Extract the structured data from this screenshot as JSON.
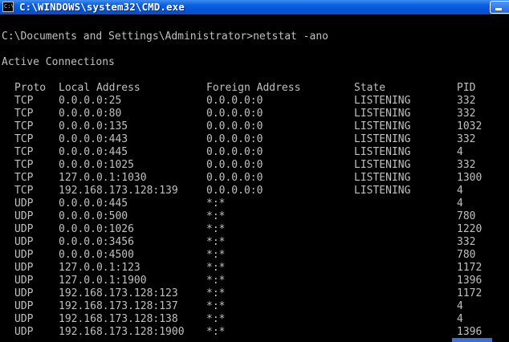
{
  "window": {
    "title": "C:\\WINDOWS\\system32\\CMD.exe",
    "icon_text": "C:\\"
  },
  "console": {
    "prompt_command": "C:\\Documents and Settings\\Administrator>netstat -ano",
    "section_heading": "Active Connections",
    "columns": {
      "proto": "Proto",
      "local": "Local Address",
      "foreign": "Foreign Address",
      "state": "State",
      "pid": "PID"
    },
    "rows": [
      {
        "proto": "TCP",
        "local": "0.0.0.0:25",
        "foreign": "0.0.0.0:0",
        "state": "LISTENING",
        "pid": "332"
      },
      {
        "proto": "TCP",
        "local": "0.0.0.0:80",
        "foreign": "0.0.0.0:0",
        "state": "LISTENING",
        "pid": "332"
      },
      {
        "proto": "TCP",
        "local": "0.0.0.0:135",
        "foreign": "0.0.0.0:0",
        "state": "LISTENING",
        "pid": "1032"
      },
      {
        "proto": "TCP",
        "local": "0.0.0.0:443",
        "foreign": "0.0.0.0:0",
        "state": "LISTENING",
        "pid": "332"
      },
      {
        "proto": "TCP",
        "local": "0.0.0.0:445",
        "foreign": "0.0.0.0:0",
        "state": "LISTENING",
        "pid": "4"
      },
      {
        "proto": "TCP",
        "local": "0.0.0.0:1025",
        "foreign": "0.0.0.0:0",
        "state": "LISTENING",
        "pid": "332"
      },
      {
        "proto": "TCP",
        "local": "127.0.0.1:1030",
        "foreign": "0.0.0.0:0",
        "state": "LISTENING",
        "pid": "1300"
      },
      {
        "proto": "TCP",
        "local": "192.168.173.128:139",
        "foreign": "0.0.0.0:0",
        "state": "LISTENING",
        "pid": "4"
      },
      {
        "proto": "UDP",
        "local": "0.0.0.0:445",
        "foreign": "*:*",
        "state": "",
        "pid": "4"
      },
      {
        "proto": "UDP",
        "local": "0.0.0.0:500",
        "foreign": "*:*",
        "state": "",
        "pid": "780"
      },
      {
        "proto": "UDP",
        "local": "0.0.0.0:1026",
        "foreign": "*:*",
        "state": "",
        "pid": "1220"
      },
      {
        "proto": "UDP",
        "local": "0.0.0.0:3456",
        "foreign": "*:*",
        "state": "",
        "pid": "332"
      },
      {
        "proto": "UDP",
        "local": "0.0.0.0:4500",
        "foreign": "*:*",
        "state": "",
        "pid": "780"
      },
      {
        "proto": "UDP",
        "local": "127.0.0.1:123",
        "foreign": "*:*",
        "state": "",
        "pid": "1172"
      },
      {
        "proto": "UDP",
        "local": "127.0.0.1:1900",
        "foreign": "*:*",
        "state": "",
        "pid": "1396"
      },
      {
        "proto": "UDP",
        "local": "192.168.173.128:123",
        "foreign": "*:*",
        "state": "",
        "pid": "1172"
      },
      {
        "proto": "UDP",
        "local": "192.168.173.128:137",
        "foreign": "*:*",
        "state": "",
        "pid": "4"
      },
      {
        "proto": "UDP",
        "local": "192.168.173.128:138",
        "foreign": "*:*",
        "state": "",
        "pid": "4"
      },
      {
        "proto": "UDP",
        "local": "192.168.173.128:1900",
        "foreign": "*:*",
        "state": "",
        "pid": "1396"
      }
    ]
  },
  "colors": {
    "console_background": "#000000",
    "console_text": "#c0c0c0",
    "titlebar_blue": "#0553d6"
  }
}
